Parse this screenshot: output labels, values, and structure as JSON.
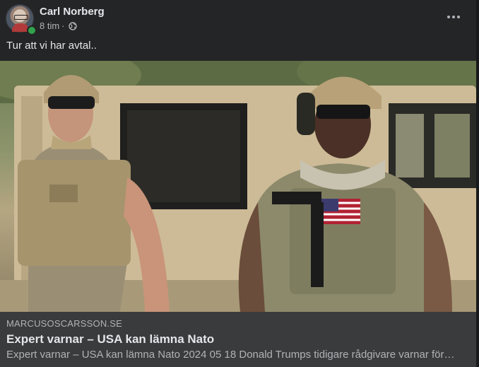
{
  "post": {
    "author": "Carl Norberg",
    "time": "8 tim",
    "separator": "·",
    "privacy_icon": "globe-icon",
    "more_icon": "more-horizontal-icon",
    "text": "Tur att vi har avtal.."
  },
  "link_preview": {
    "domain": "MARCUSOSCARSSON.SE",
    "title": "Expert varnar – USA kan lämna Nato",
    "description": "Expert varnar – USA kan lämna Nato 2024 05 18 Donald Trumps tidigare rådgivare varnar för…"
  },
  "colors": {
    "card_bg": "#242526",
    "link_bg": "#3a3b3c",
    "primary_text": "#e4e6eb",
    "secondary_text": "#b0b3b8",
    "online": "#31a24c"
  }
}
